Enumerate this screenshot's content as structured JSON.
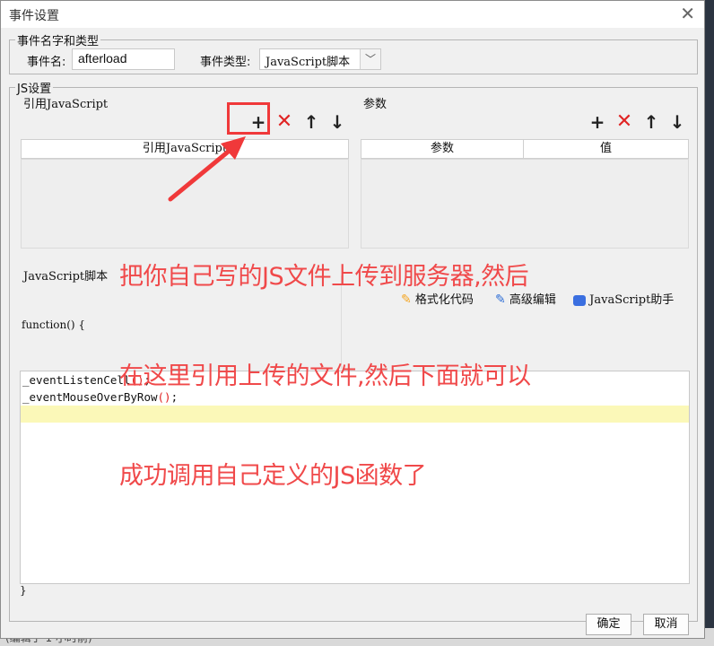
{
  "background": {
    "status_text": "(编辑于 1 小时前)"
  },
  "dialog": {
    "title": "事件设置"
  },
  "name_section": {
    "legend": "事件名字和类型",
    "name_label": "事件名:",
    "name_value": "afterload",
    "type_label": "事件类型:",
    "type_value": "JavaScript脚本"
  },
  "js_section": {
    "legend": "JS设置",
    "ref_title": "引用JavaScript",
    "params_title": "参数",
    "ref_table": {
      "columns": [
        "引用JavaScript"
      ]
    },
    "params_table": {
      "columns": [
        "参数",
        "值"
      ]
    },
    "script_title": "JavaScript脚本",
    "function_header": "function() {",
    "toolbar": {
      "format_label": "格式化代码",
      "advanced_label": "高级编辑",
      "assistant_label": "JavaScript助手"
    },
    "code_lines": [
      {
        "name": "_eventListenCell",
        "paren": "()",
        "end": ";"
      },
      {
        "name": "_eventMouseOverByRow",
        "paren": "()",
        "end": ";"
      }
    ],
    "closing_brace": "}"
  },
  "buttons": {
    "confirm": "确定",
    "cancel": "取消"
  },
  "annotation": {
    "lines": [
      "把你自己写的JS文件上传到服务器,然后",
      "在这里引用上传的文件,然后下面就可以",
      "成功调用自己定义的JS函数了"
    ],
    "color": "#f0494a"
  },
  "colors": {
    "delete_icon": "#e02424",
    "highlight": "#fbf8b8",
    "accent_red": "#f0393a"
  }
}
